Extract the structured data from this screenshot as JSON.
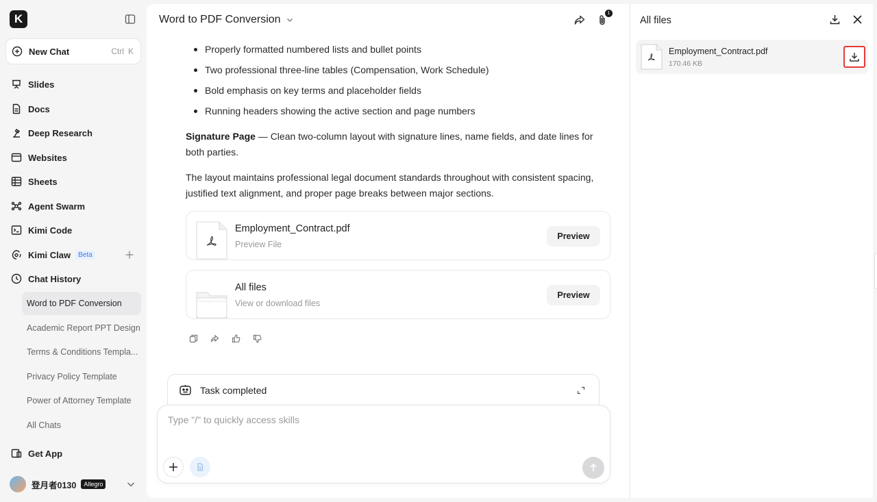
{
  "sidebar": {
    "logo": "K",
    "new_chat": {
      "label": "New Chat",
      "kbd_ctrl": "Ctrl",
      "kbd_key": "K"
    },
    "nav": [
      {
        "label": "Slides",
        "icon": "presentation-icon"
      },
      {
        "label": "Docs",
        "icon": "document-icon"
      },
      {
        "label": "Deep Research",
        "icon": "research-icon"
      },
      {
        "label": "Websites",
        "icon": "browser-icon"
      },
      {
        "label": "Sheets",
        "icon": "table-icon"
      },
      {
        "label": "Agent Swarm",
        "icon": "swarm-icon"
      },
      {
        "label": "Kimi Code",
        "icon": "terminal-icon"
      },
      {
        "label": "Kimi Claw",
        "icon": "claw-icon",
        "badge": "Beta"
      },
      {
        "label": "Chat History",
        "icon": "clock-icon"
      }
    ],
    "history": [
      {
        "label": "Word to PDF Conversion",
        "active": true
      },
      {
        "label": "Academic Report PPT Design"
      },
      {
        "label": "Terms & Conditions Templa..."
      },
      {
        "label": "Privacy Policy Template"
      },
      {
        "label": "Power of Attorney Template"
      },
      {
        "label": "All Chats"
      }
    ],
    "get_app": "Get App",
    "user": {
      "name": "登月者0130",
      "plan": "Allegro"
    }
  },
  "main": {
    "title": "Word to PDF Conversion",
    "attachment_count": "1",
    "bullets": [
      "Properly formatted numbered lists and bullet points",
      "Two professional three-line tables (Compensation, Work Schedule)",
      "Bold emphasis on key terms and placeholder fields",
      "Running headers showing the active section and page numbers"
    ],
    "signature_bold": "Signature Page",
    "signature_text": " — Clean two-column layout with signature lines, name fields, and date lines for both parties.",
    "layout_text": "The layout maintains professional legal document standards throughout with consistent spacing, justified text alignment, and proper page breaks between major sections.",
    "cards": [
      {
        "name": "Employment_Contract.pdf",
        "sub": "Preview File",
        "button": "Preview"
      },
      {
        "name": "All files",
        "sub": "View or download files",
        "button": "Preview"
      }
    ],
    "task_label": "Task completed",
    "input_placeholder": "Type \"/\" to quickly access skills"
  },
  "panel": {
    "title": "All files",
    "file": {
      "name": "Employment_Contract.pdf",
      "size": "170.46 KB"
    }
  },
  "colors": {
    "accent_blue": "#3b7bea",
    "highlight_red": "#e53935"
  }
}
